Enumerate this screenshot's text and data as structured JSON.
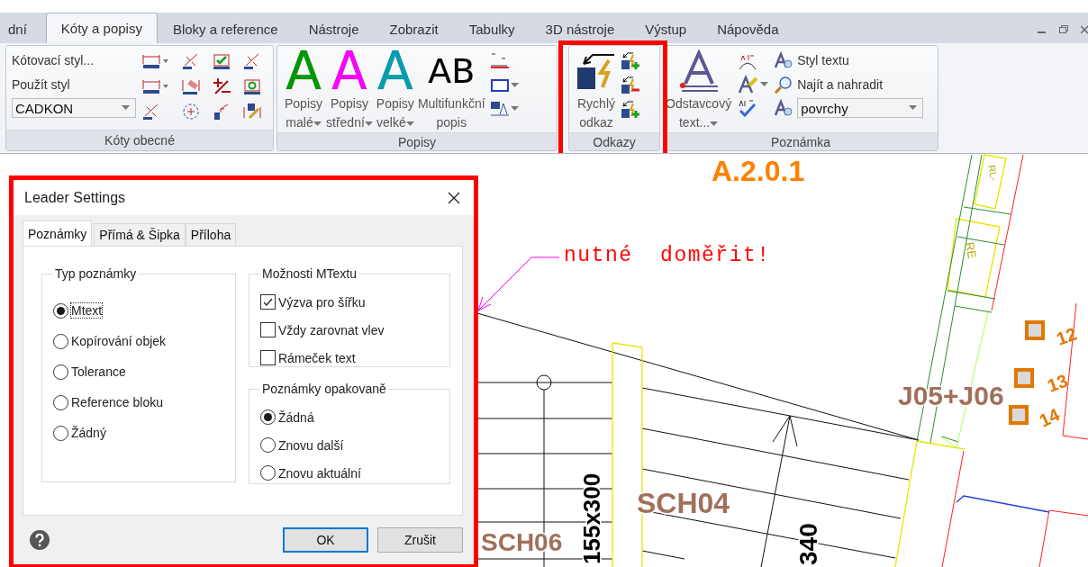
{
  "ribbon_tabs": [
    {
      "label": "dní",
      "selected": false
    },
    {
      "label": "Kóty a popisy",
      "selected": true
    },
    {
      "label": "Bloky a reference",
      "selected": false
    },
    {
      "label": "Nástroje",
      "selected": false
    },
    {
      "label": "Zobrazit",
      "selected": false
    },
    {
      "label": "Tabulky",
      "selected": false
    },
    {
      "label": "3D nástroje",
      "selected": false
    },
    {
      "label": "Výstup",
      "selected": false
    },
    {
      "label": "Nápověda",
      "selected": false
    }
  ],
  "dimensions_panel": {
    "title": "Kóty obecné",
    "commands": [
      "Kótovací styl...",
      "Použít styl"
    ],
    "style_combo": "CADKON"
  },
  "labels_panel": {
    "title": "Popisy",
    "buttons": [
      {
        "glyph": "A",
        "color": "#009900",
        "lines": [
          "Popisy",
          "malé"
        ],
        "dropdown": true
      },
      {
        "glyph": "A",
        "color": "#ff00ff",
        "lines": [
          "Popisy",
          "střední"
        ],
        "dropdown": true
      },
      {
        "glyph": "A",
        "color": "#00a0b0",
        "lines": [
          "Popisy",
          "velké"
        ],
        "dropdown": true
      },
      {
        "glyph": "AB",
        "color": "#000000",
        "lines": [
          "Multifunkční",
          "popis"
        ],
        "dropdown": false
      }
    ]
  },
  "leaders_panel": {
    "title": "Odkazy",
    "lines": [
      "Rychlý",
      "odkaz"
    ],
    "highlighted": true
  },
  "note_panel": {
    "title": "Poznámka",
    "lines": [
      "Odstavcový",
      "text..."
    ],
    "dropdown": true,
    "commands": [
      "Styl textu",
      "Najít a nahradit"
    ],
    "style_combo": "povrchy"
  },
  "drawing": {
    "labels": [
      {
        "text": "A.2.0.1",
        "color": "#ff8000"
      },
      {
        "text": "nutné  doměřit!",
        "color": "#ff0000"
      },
      {
        "text": "J05+J06",
        "color": "#a0705a"
      },
      {
        "text": "12",
        "color": "#e07800"
      },
      {
        "text": "13",
        "color": "#e07800"
      },
      {
        "text": "14",
        "color": "#e07800"
      },
      {
        "text": "SCH04",
        "color": "#a0705a"
      },
      {
        "text": "SCH06",
        "color": "#a0705a"
      },
      {
        "text": "155x300",
        "color": "#000000"
      },
      {
        "text": "340",
        "color": "#000000"
      },
      {
        "text": "RL-",
        "color": "#b8a800"
      },
      {
        "text": "RE",
        "color": "#b8a800"
      }
    ]
  },
  "dialog": {
    "title": "Leader Settings",
    "highlighted": true,
    "tabs": [
      {
        "label": "Poznámky",
        "selected": true
      },
      {
        "label": "Přímá & Šipka",
        "selected": false
      },
      {
        "label": "Příloha",
        "selected": false
      }
    ],
    "note_type": {
      "title": "Typ poznámky",
      "options": [
        {
          "label": "Mtext",
          "selected": true
        },
        {
          "label": "Kopírování objek",
          "selected": false
        },
        {
          "label": "Tolerance",
          "selected": false
        },
        {
          "label": "Reference bloku",
          "selected": false
        },
        {
          "label": "Žádný",
          "selected": false
        }
      ]
    },
    "mtext_options": {
      "title": "Možnosti MTextu",
      "options": [
        {
          "label": "Výzva pro šířku",
          "checked": true
        },
        {
          "label": "Vždy zarovnat vlev",
          "checked": false
        },
        {
          "label": "Rámeček text",
          "checked": false
        }
      ]
    },
    "repeat": {
      "title": "Poznámky opakovaně",
      "options": [
        {
          "label": "Žádná",
          "selected": true
        },
        {
          "label": "Znovu další",
          "selected": false
        },
        {
          "label": "Znovu aktuální",
          "selected": false
        }
      ]
    },
    "buttons": [
      "OK",
      "Zrušit"
    ]
  }
}
